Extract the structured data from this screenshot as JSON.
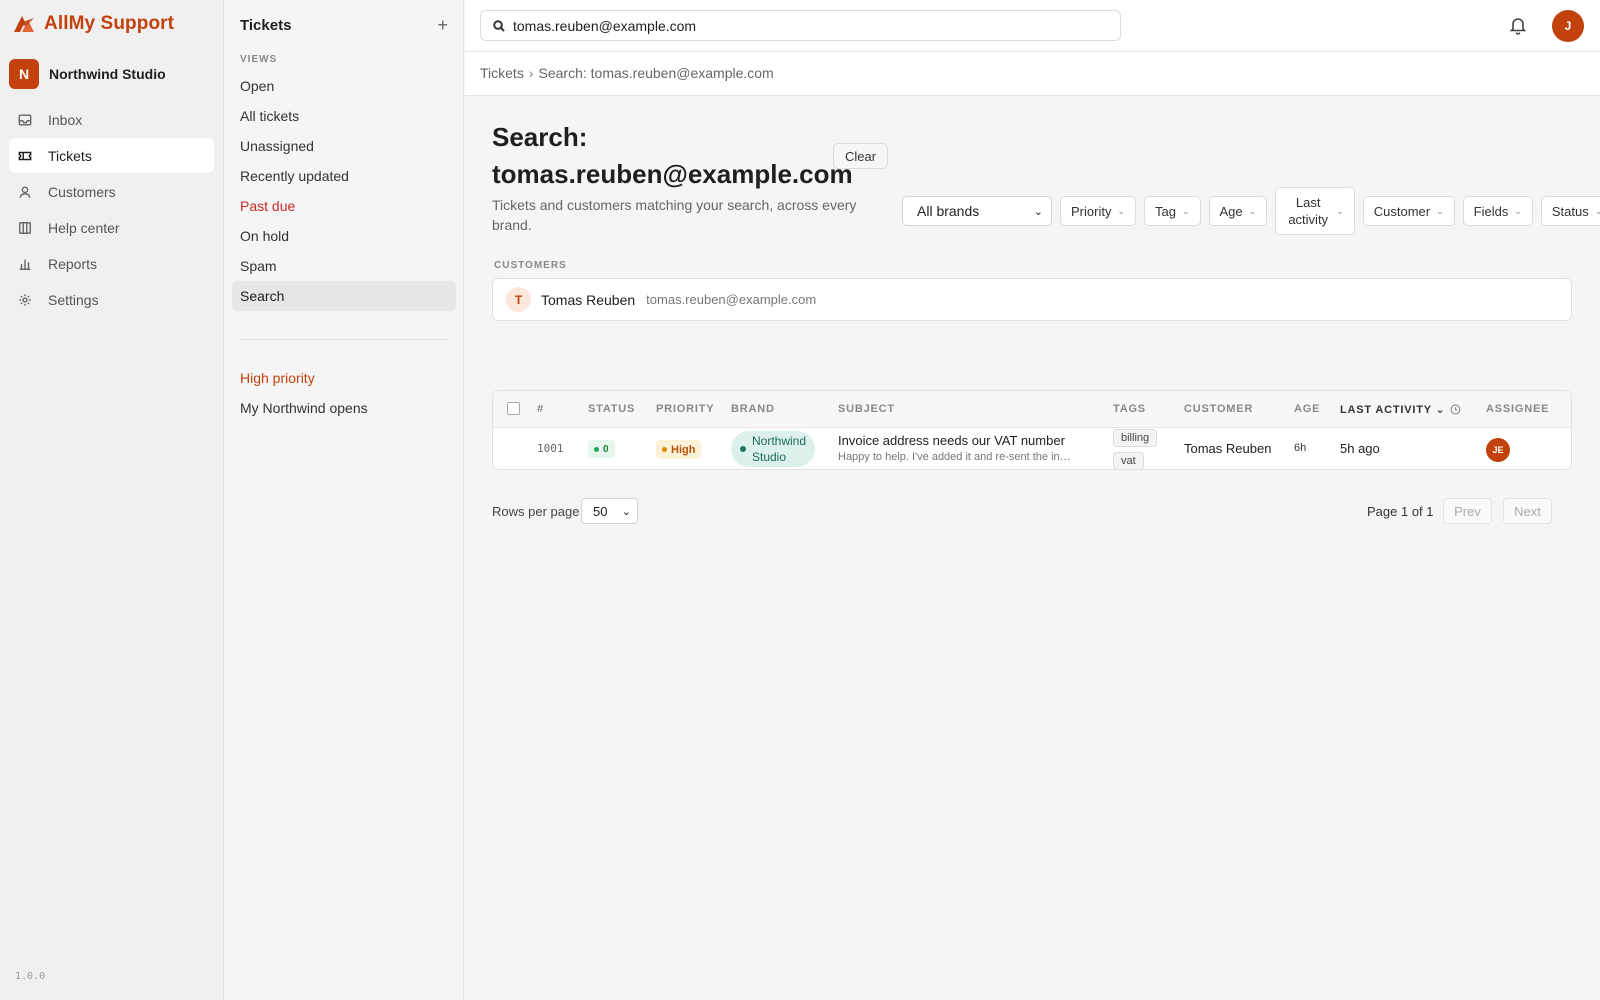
{
  "app": {
    "name": "AllMy Support",
    "version": "1.0.0",
    "accent": "#c2410c"
  },
  "workspace": {
    "initial": "N",
    "name": "Northwind Studio"
  },
  "nav": [
    {
      "label": "Inbox",
      "icon": "inbox-icon"
    },
    {
      "label": "Tickets",
      "icon": "ticket-icon",
      "active": true
    },
    {
      "label": "Customers",
      "icon": "user-icon"
    },
    {
      "label": "Help center",
      "icon": "book-icon"
    },
    {
      "label": "Reports",
      "icon": "bar-chart-icon"
    },
    {
      "label": "Settings",
      "icon": "gear-icon"
    }
  ],
  "views": {
    "title": "Tickets",
    "add_label": "+",
    "section_label": "VIEWS",
    "items": [
      "Open",
      "All tickets",
      "Unassigned",
      "Recently updated",
      "Past due",
      "On hold",
      "Spam",
      "Search"
    ],
    "saved": [
      "High priority",
      "My Northwind opens"
    ]
  },
  "topbar": {
    "search_value": "tomas.reuben@example.com",
    "user_initial": "J"
  },
  "breadcrumb": {
    "root": "Tickets",
    "sep": "›",
    "current": "Search: tomas.reuben@example.com"
  },
  "page": {
    "title": "Search: tomas.reuben@example.com",
    "clear_label": "Clear",
    "subtitle": "Tickets and customers matching your search, across every brand."
  },
  "filters": {
    "brand_selected": "All brands",
    "buttons": [
      "Priority",
      "Tag",
      "Age",
      "Last activity",
      "Customer",
      "Fields",
      "Status"
    ]
  },
  "customers": {
    "label": "CUSTOMERS",
    "items": [
      {
        "initial": "T",
        "name": "Tomas Reuben",
        "email": "tomas.reuben@example.com"
      }
    ]
  },
  "table": {
    "columns": {
      "id": "#",
      "status": "STATUS",
      "priority": "PRIORITY",
      "brand": "BRAND",
      "subject": "SUBJECT",
      "tags": "TAGS",
      "customer": "CUSTOMER",
      "age": "AGE",
      "last_activity": "LAST ACTIVITY",
      "assignee": "ASSIGNEE"
    },
    "rows": [
      {
        "id": "1001",
        "status": "0",
        "priority": "High",
        "brand": "Northwind Studio",
        "subject": "Invoice address needs our VAT number",
        "preview": "Happy to help. I've added it and re-sent the in…",
        "tags": [
          "billing",
          "vat"
        ],
        "customer": "Tomas Reuben",
        "age": "6h",
        "last_activity": "5h ago",
        "assignee": "JE"
      }
    ]
  },
  "pagination": {
    "rows_label": "Rows per page",
    "rows_value": "50",
    "page_info": "Page 1 of 1",
    "prev": "Prev",
    "next": "Next"
  }
}
